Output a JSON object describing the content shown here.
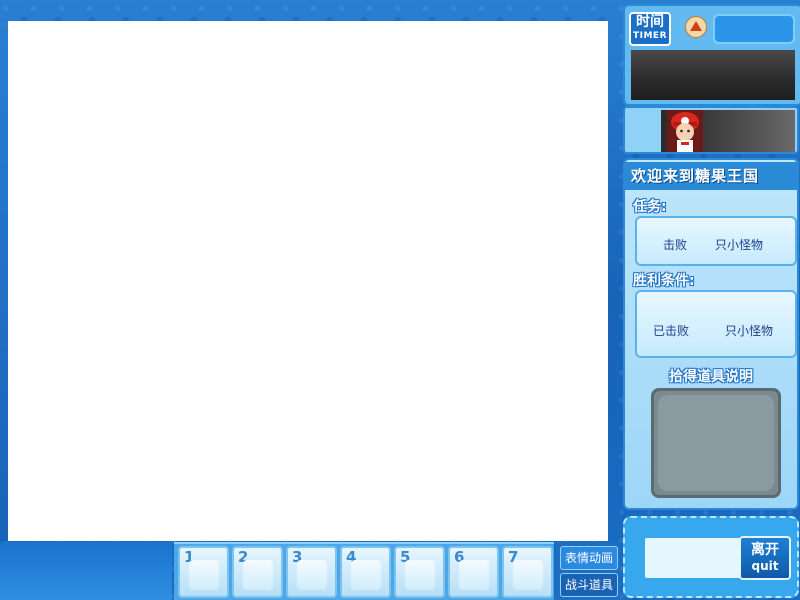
{
  "timer": {
    "logo_cn": "时间",
    "logo_en": "TIMER"
  },
  "info": {
    "welcome": "欢迎来到糖果王国",
    "task_label": "任务:",
    "task_text_left": "击败",
    "task_text_right": "只小怪物",
    "victory_label": "胜利条件:",
    "victory_text_left": "已击败",
    "victory_text_right": "只小怪物",
    "pickup_title": "拾得道具说明"
  },
  "quit": {
    "cn": "离开",
    "en": "quit"
  },
  "item_slots": [
    "1",
    "2",
    "3",
    "4",
    "5",
    "6",
    "7"
  ],
  "mode_buttons": {
    "emote": "表情动画",
    "battle_items": "战斗道具"
  },
  "colors": {
    "background": "#1f6fc0",
    "panel_border": "#2a8ad6",
    "game_area": "#ffffff"
  },
  "icons": {
    "rank": "rank-badge-icon",
    "avatar": "player-avatar"
  }
}
